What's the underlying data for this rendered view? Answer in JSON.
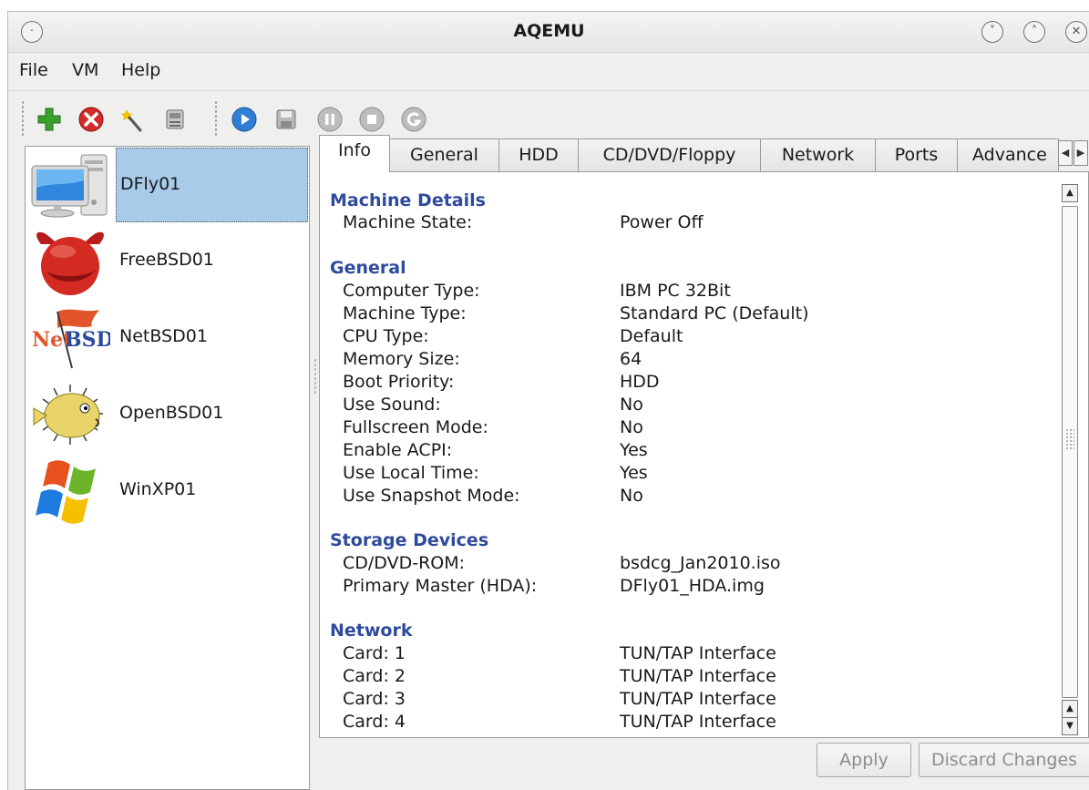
{
  "window": {
    "title": "AQEMU"
  },
  "menu": {
    "file": "File",
    "vm": "VM",
    "help": "Help"
  },
  "toolbar": {
    "buttons": [
      "add-vm-icon",
      "delete-vm-icon",
      "wizard-icon",
      "manager-icon",
      "start-icon",
      "save-icon",
      "pause-icon",
      "stop-icon",
      "reset-icon"
    ]
  },
  "vms": [
    {
      "name": "DFly01",
      "icon": "computer-icon",
      "selected": true
    },
    {
      "name": "FreeBSD01",
      "icon": "freebsd-icon"
    },
    {
      "name": "NetBSD01",
      "icon": "netbsd-icon",
      "logo_text": "NetBSD"
    },
    {
      "name": "OpenBSD01",
      "icon": "openbsd-icon"
    },
    {
      "name": "WinXP01",
      "icon": "windows-icon"
    }
  ],
  "tabs": [
    "Info",
    "General",
    "HDD",
    "CD/DVD/Floppy",
    "Network",
    "Ports",
    "Advance"
  ],
  "info": {
    "machine_details": {
      "title": "Machine Details",
      "rows": [
        {
          "label": "Machine State:",
          "value": "Power Off"
        }
      ]
    },
    "general": {
      "title": "General",
      "rows": [
        {
          "label": "Computer Type:",
          "value": "IBM PC 32Bit"
        },
        {
          "label": "Machine Type:",
          "value": "Standard PC (Default)"
        },
        {
          "label": "CPU Type:",
          "value": "Default"
        },
        {
          "label": "Memory Size:",
          "value": "64"
        },
        {
          "label": "Boot Priority:",
          "value": "HDD"
        },
        {
          "label": "Use Sound:",
          "value": "No"
        },
        {
          "label": "Fullscreen Mode:",
          "value": "No"
        },
        {
          "label": "Enable ACPI:",
          "value": "Yes"
        },
        {
          "label": "Use Local Time:",
          "value": "Yes"
        },
        {
          "label": "Use Snapshot Mode:",
          "value": "No"
        }
      ]
    },
    "storage": {
      "title": "Storage Devices",
      "rows": [
        {
          "label": "CD/DVD-ROM:",
          "value": "bsdcg_Jan2010.iso"
        },
        {
          "label": "Primary Master (HDA):",
          "value": "DFly01_HDA.img"
        }
      ]
    },
    "network": {
      "title": "Network",
      "rows": [
        {
          "label": "Card: 1",
          "value": "TUN/TAP Interface"
        },
        {
          "label": "Card: 2",
          "value": "TUN/TAP Interface"
        },
        {
          "label": "Card: 3",
          "value": "TUN/TAP Interface"
        },
        {
          "label": "Card: 4",
          "value": "TUN/TAP Interface"
        }
      ]
    }
  },
  "buttons": {
    "apply": "Apply",
    "discard": "Discard Changes"
  },
  "colors": {
    "section_title": "#2e4a9e",
    "selection": "#a8cbea"
  }
}
